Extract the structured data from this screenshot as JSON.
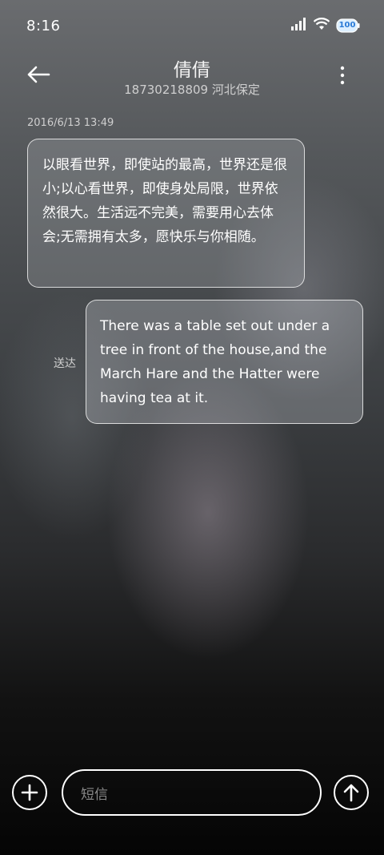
{
  "status": {
    "time": "8:16",
    "battery_label": "100",
    "icons": [
      "signal-icon",
      "wifi-icon",
      "battery-icon"
    ]
  },
  "header": {
    "contact_name": "倩倩",
    "contact_detail": "18730218809 河北保定",
    "back_icon": "back-arrow-icon",
    "more_icon": "more-vertical-icon"
  },
  "conversation": {
    "timestamp": "2016/6/13 13:49",
    "messages": [
      {
        "direction": "incoming",
        "text": "以眼看世界，即使站的最高，世界还是很小;以心看世界，即使身处局限，世界依然很大。生活远不完美，需要用心去体会;无需拥有太多，愿快乐与你相随。"
      },
      {
        "direction": "outgoing",
        "text": "There was a table set out under a tree in front of the house,and the March Hare and the Hatter were having tea at it.",
        "status": "送达"
      }
    ]
  },
  "composer": {
    "placeholder": "短信",
    "add_icon": "plus-icon",
    "send_icon": "send-arrow-up-icon"
  },
  "colors": {
    "bubble_border": "#ffffff",
    "text_primary": "#ffffff",
    "text_secondary": "#cfcfcf",
    "placeholder": "#8a8a8a"
  }
}
